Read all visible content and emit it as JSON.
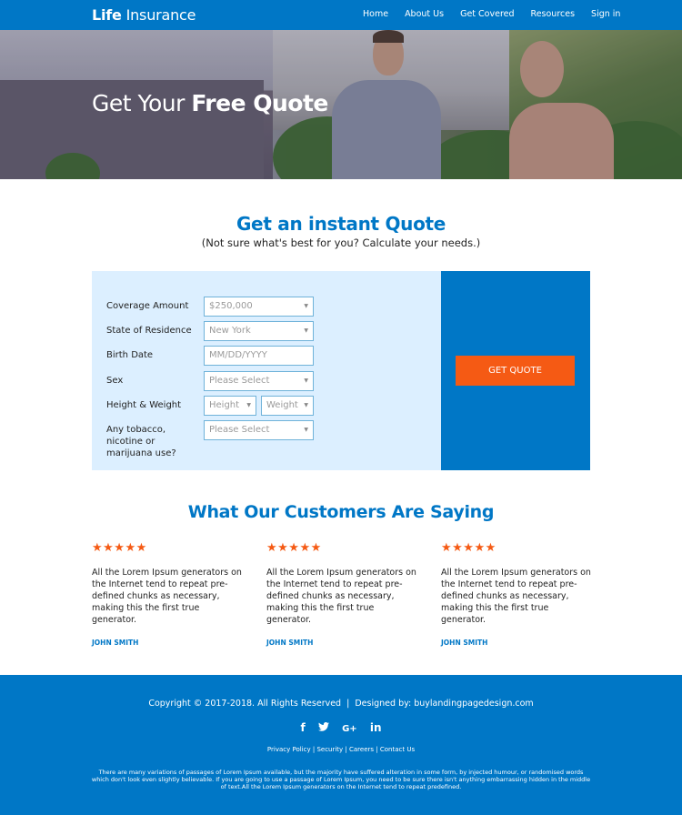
{
  "header": {
    "logo_bold": "Life",
    "logo_light": "Insurance",
    "nav": [
      "Home",
      "About Us",
      "Get Covered",
      "Resources",
      "Sign in"
    ],
    "brand_color": "#0077c6"
  },
  "hero": {
    "title_light": "Get Your",
    "title_bold": "Free Quote"
  },
  "quote": {
    "title": "Get an instant Quote",
    "subtitle": "(Not sure what's best for you? Calculate your needs.)",
    "fields": [
      {
        "label": "Coverage Amount",
        "value": "$250,000",
        "type": "select"
      },
      {
        "label": "State of Residence",
        "value": "New York",
        "type": "select"
      },
      {
        "label": "Birth Date",
        "placeholder": "MM/DD/YYYY",
        "type": "text"
      },
      {
        "label": "Sex",
        "value": "Please Select",
        "type": "select"
      },
      {
        "label": "Height & Weight",
        "height_value": "Height",
        "weight_value": "Weight",
        "type": "select-pair"
      },
      {
        "label": "Any tobacco, nicotine or marijuana use?",
        "value": "Please Select",
        "type": "select"
      }
    ],
    "cta_label": "GET QUOTE",
    "cta_color": "#f55a14"
  },
  "testimonials": {
    "title": "What Our Customers Are Saying",
    "items": [
      {
        "stars": "★★★★★",
        "rating": 5,
        "text": "All the Lorem Ipsum generators on the Internet tend to repeat pre-defined chunks as necessary, making this the first true generator.",
        "name": "JOHN SMITH"
      },
      {
        "stars": "★★★★★",
        "rating": 5,
        "text": "All the Lorem Ipsum generators on the Internet tend to repeat pre-defined chunks as necessary, making this the first true generator.",
        "name": "JOHN SMITH"
      },
      {
        "stars": "★★★★★",
        "rating": 5,
        "text": "All the Lorem Ipsum generators on the Internet tend to repeat pre-defined chunks as necessary, making this the first true generator.",
        "name": "JOHN SMITH"
      }
    ]
  },
  "footer": {
    "copyright": "Copyright © 2017-2018. All Rights Reserved  |  Designed by: buylandingpagedesign.com",
    "socials": [
      {
        "icon": "facebook-icon",
        "glyph": "f"
      },
      {
        "icon": "twitter-icon",
        "glyph": "🐦"
      },
      {
        "icon": "google-plus-icon",
        "glyph": "G+"
      },
      {
        "icon": "linkedin-icon",
        "glyph": "in"
      }
    ],
    "links": [
      "Privacy Policy",
      "Security",
      "Careers",
      "Contact Us"
    ],
    "separator": " | ",
    "disclaimer": "There are many variations of passages of Lorem Ipsum available, but the majority have suffered alteration in some form, by injected humour, or randomised words which don't look even slightly believable. If you are going to use a passage of Lorem Ipsum, you need to be sure there isn't anything embarrassing hidden in the middle of text.All the Lorem Ipsum generators on the Internet tend to repeat predefined."
  }
}
